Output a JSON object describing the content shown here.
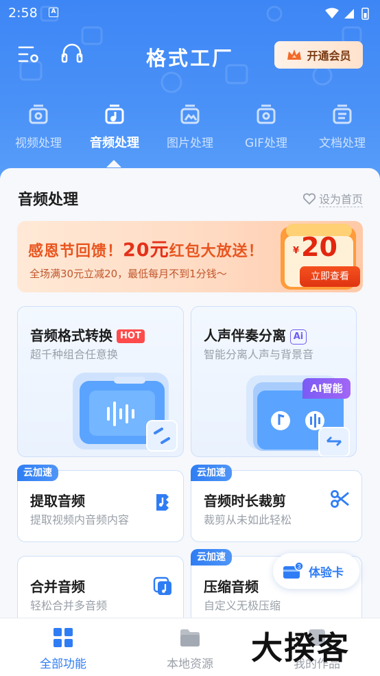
{
  "status_bar": {
    "time": "2:58",
    "app_icon": "A"
  },
  "header": {
    "title": "格式工厂",
    "vip_button": "开通会员",
    "icons": [
      "menu-settings-icon",
      "headset-icon",
      "crown-icon"
    ]
  },
  "categories": [
    {
      "label": "视频处理",
      "icon": "video-icon",
      "active": false
    },
    {
      "label": "音频处理",
      "icon": "audio-icon",
      "active": true
    },
    {
      "label": "图片处理",
      "icon": "image-icon",
      "active": false
    },
    {
      "label": "GIF处理",
      "icon": "gif-icon",
      "active": false
    },
    {
      "label": "文档处理",
      "icon": "document-icon",
      "active": false
    }
  ],
  "section": {
    "title": "音频处理",
    "set_home": "设为首页"
  },
  "banner": {
    "headline_a": "感恩节回馈！",
    "headline_b": "20元",
    "headline_c": "红包大放送！",
    "sub": "全场满30元立减20，最低每月不到1分钱～",
    "currency": "¥",
    "amount": "20",
    "button": "立即查看"
  },
  "cards": {
    "convert": {
      "name": "音频格式转换",
      "badge": "HOT",
      "desc": "超千种组合任意换"
    },
    "separate": {
      "name": "人声伴奏分离",
      "badge": "Ai",
      "desc": "智能分离人声与背景音",
      "tag": "AI智能"
    },
    "extract": {
      "tag": "云加速",
      "name": "提取音频",
      "desc": "提取视频内音频内容"
    },
    "trim": {
      "tag": "云加速",
      "name": "音频时长裁剪",
      "desc": "裁剪从未如此轻松"
    },
    "merge": {
      "name": "合并音频",
      "desc": "轻松合并多音频"
    },
    "compress": {
      "tag": "云加速",
      "name": "压缩音频",
      "desc": "自定义无极压缩"
    }
  },
  "trial_card": {
    "count": "3",
    "label": "体验卡"
  },
  "bottom_nav": [
    {
      "label": "全部功能",
      "icon": "grid-icon",
      "active": true
    },
    {
      "label": "本地资源",
      "icon": "folder-icon",
      "active": false
    },
    {
      "label": "我的作品",
      "icon": "works-icon",
      "active": false
    }
  ],
  "watermark": "大揆客",
  "colors": {
    "primary": "#2f7df4",
    "header": "#4a91f7",
    "hot": "#ff4b4b",
    "banner_red": "#e4311a"
  }
}
